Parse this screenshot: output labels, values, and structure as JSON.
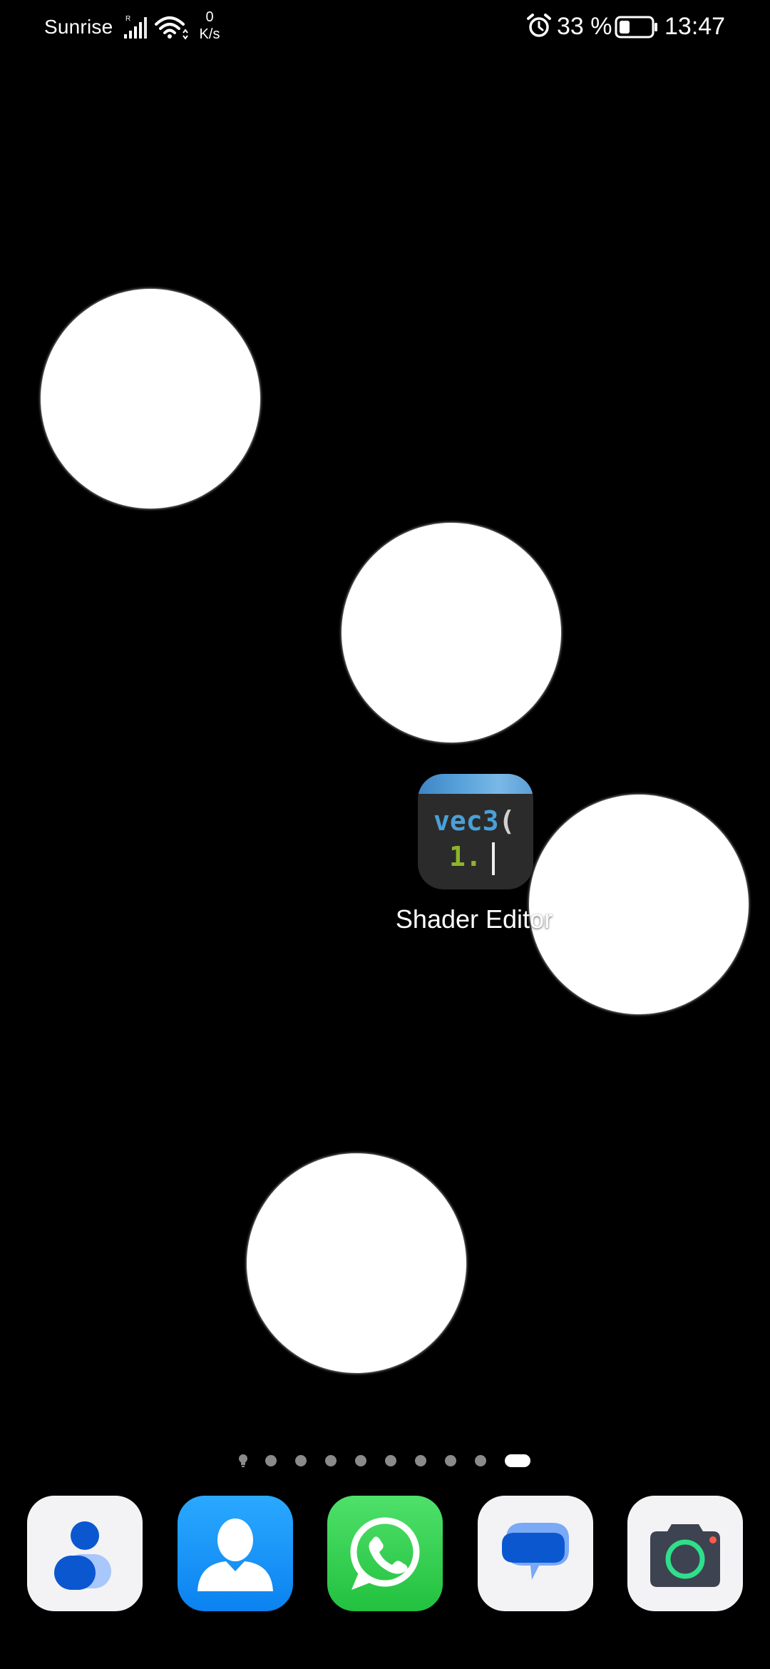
{
  "status_bar": {
    "carrier": "Sunrise",
    "signal_roaming_mark": "R",
    "net_speed_value": "0",
    "net_speed_unit": "K/s",
    "battery_percent": "33 %",
    "battery_level": 0.33,
    "time": "13:47",
    "icons": [
      "signal-icon",
      "wifi-icon",
      "alarm-icon",
      "battery-icon"
    ]
  },
  "home": {
    "apps": [
      {
        "label": "Shader Editor",
        "icon": "shader-editor-icon",
        "icon_text_line1": "vec3(",
        "icon_text_line2": "1."
      }
    ],
    "wallpaper": {
      "background": "#000000",
      "circle_color": "#ffffff",
      "circle_count": 4
    },
    "pages": {
      "count": 9,
      "current": 9,
      "leading_icon": "bulb-icon"
    }
  },
  "dock": {
    "apps": [
      {
        "name": "Contacts (Google)",
        "icon": "contacts-person-icon"
      },
      {
        "name": "Contacts",
        "icon": "contact-silhouette-icon"
      },
      {
        "name": "WhatsApp",
        "icon": "whatsapp-icon"
      },
      {
        "name": "Messages",
        "icon": "messages-icon"
      },
      {
        "name": "Camera",
        "icon": "camera-icon"
      }
    ]
  },
  "colors": {
    "accent_blue": "#0b82f0",
    "whatsapp_green": "#22c13f",
    "messages_blue": "#4d8bf0",
    "camera_ring": "#2ee08a",
    "page_dot": "#8a8a8a"
  }
}
